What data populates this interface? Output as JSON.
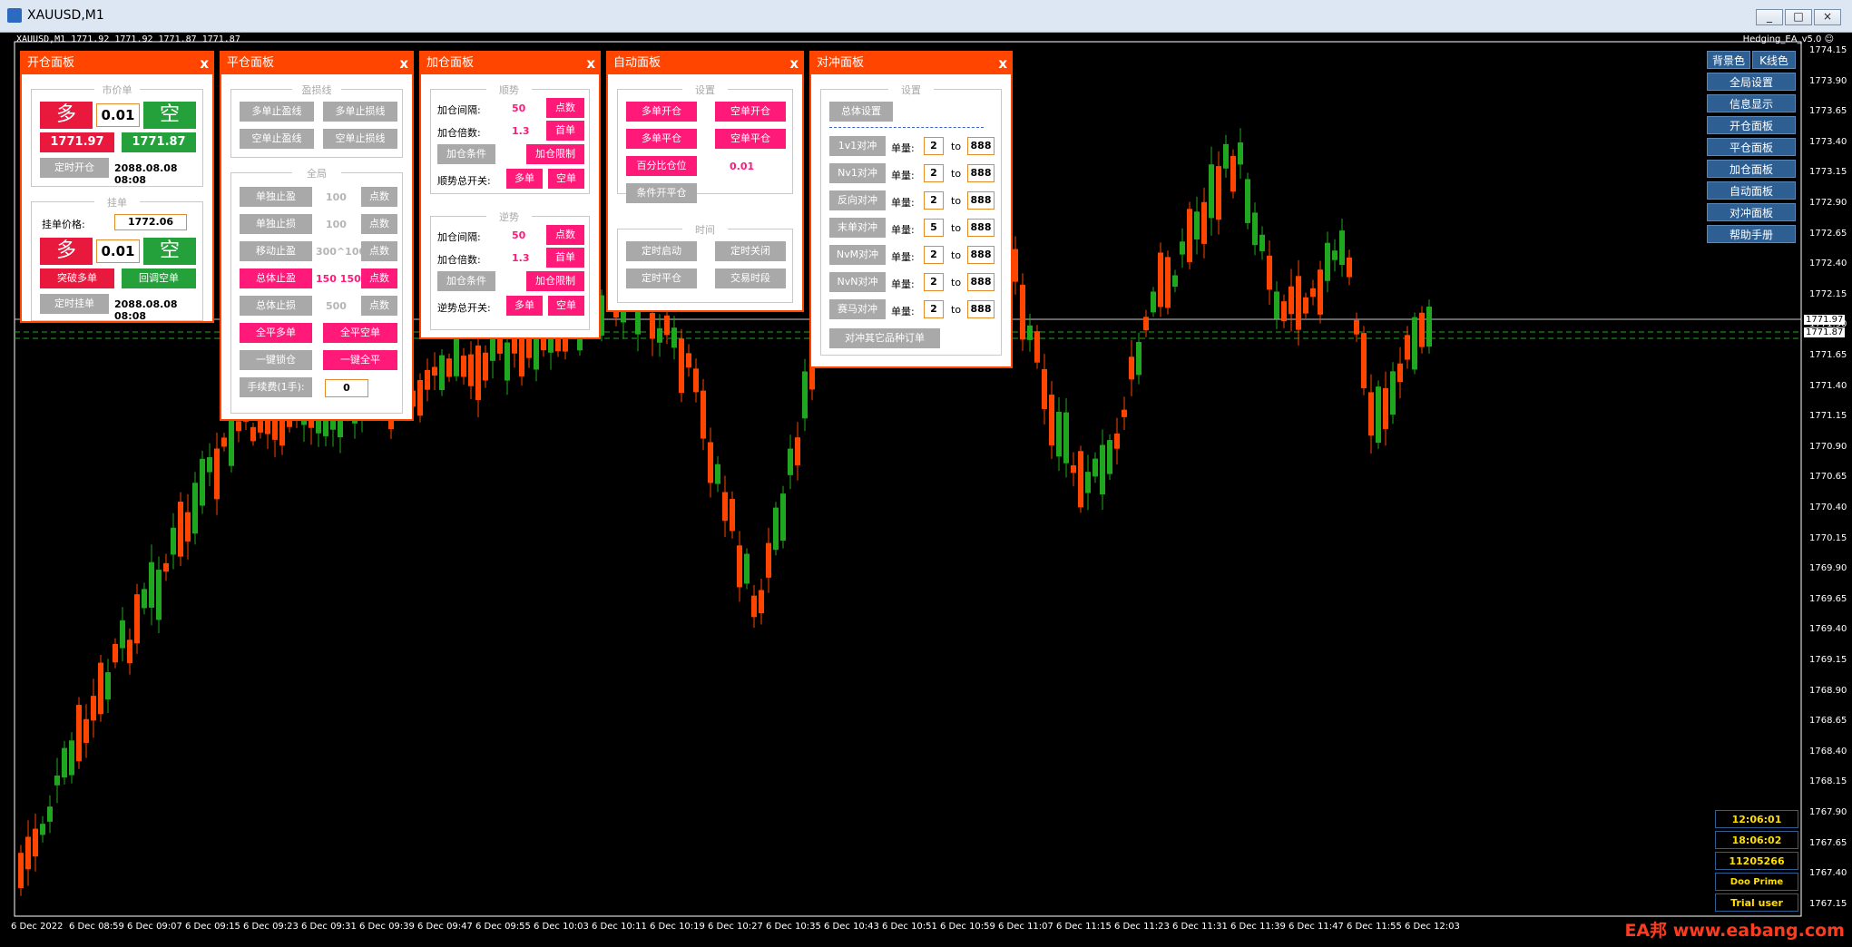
{
  "window": {
    "title": "XAUUSD,M1",
    "min": "_",
    "max": "□",
    "close": "×"
  },
  "status_line": "XAUUSD,M1  1771.92 1771.92 1771.87 1771.87",
  "ea_label": "Hedging_EA_v5.0 ☺",
  "price_axis": [
    "1774.15",
    "1773.90",
    "1773.65",
    "1773.40",
    "1773.15",
    "1772.90",
    "1772.65",
    "1772.40",
    "1772.15",
    "1771.90",
    "1771.65",
    "1771.40",
    "1771.15",
    "1770.90",
    "1770.65",
    "1770.40",
    "1770.15",
    "1769.90",
    "1769.65",
    "1769.40",
    "1769.15",
    "1768.90",
    "1768.65",
    "1768.40",
    "1768.15",
    "1767.90",
    "1767.65",
    "1767.40",
    "1767.15"
  ],
  "price_tags": {
    "bid": "1771.97",
    "ask": "1771.87"
  },
  "time_axis": [
    "6 Dec 2022",
    "6 Dec 08:59",
    "6 Dec 09:07",
    "6 Dec 09:15",
    "6 Dec 09:23",
    "6 Dec 09:31",
    "6 Dec 09:39",
    "6 Dec 09:47",
    "6 Dec 09:55",
    "6 Dec 10:03",
    "6 Dec 10:11",
    "6 Dec 10:19",
    "6 Dec 10:27",
    "6 Dec 10:35",
    "6 Dec 10:43",
    "6 Dec 10:51",
    "6 Dec 10:59",
    "6 Dec 11:07",
    "6 Dec 11:15",
    "6 Dec 11:23",
    "6 Dec 11:31",
    "6 Dec 11:39",
    "6 Dec 11:47",
    "6 Dec 11:55",
    "6 Dec 12:03"
  ],
  "colors": {
    "bull": "#1fa81f",
    "bear": "#ff4500",
    "panel": "#ff4500",
    "pink": "#ff1a7a",
    "menu": "#2e5f93"
  },
  "open_panel": {
    "title": "开仓面板",
    "close": "x",
    "market": "市价单",
    "buy": "多",
    "sell": "空",
    "lots": "0.01",
    "buy_price": "1771.97",
    "sell_price": "1771.87",
    "timed_open": "定时开仓",
    "timed_time": "2088.08.08 08:08",
    "pending": "挂单",
    "pending_price_label": "挂单价格:",
    "pending_price": "1772.06",
    "lots2": "0.01",
    "breakout_buy": "突破多单",
    "pullback_sell": "回调空单",
    "timed_pending": "定时挂单",
    "timed_time2": "2088.08.08 08:08"
  },
  "close_panel": {
    "title": "平仓面板",
    "close": "x",
    "group1": "盈损线",
    "b1": "多单止盈线",
    "b2": "多单止损线",
    "b3": "空单止盈线",
    "b4": "空单止损线",
    "group2": "全局",
    "r1": "单独止盈",
    "r1v": "100",
    "r2": "单独止损",
    "r2v": "100",
    "r3": "移动止盈",
    "r3v": "300^100",
    "r4": "总体止盈",
    "r4v": "150 150",
    "r5": "总体止损",
    "r5v": "500",
    "pts": "点数",
    "close_buy": "全平多单",
    "close_sell": "全平空单",
    "lock": "一键锁仓",
    "close_all": "一键全平",
    "fee_label": "手续费(1手):",
    "fee": "0"
  },
  "add_panel": {
    "title": "加仓面板",
    "close": "x",
    "g1": "顺势",
    "g2": "逆势",
    "interval": "加仓间隔:",
    "interval_v": "50",
    "pts": "点数",
    "mult": "加仓倍数:",
    "mult_v": "1.3",
    "first": "首单",
    "cond": "加仓条件",
    "limit": "加仓限制",
    "trend_switch": "顺势总开关:",
    "counter_switch": "逆势总开关:",
    "buy": "多单",
    "sell": "空单"
  },
  "auto_panel": {
    "title": "自动面板",
    "close": "x",
    "g1": "设置",
    "b1": "多单开仓",
    "b2": "空单开仓",
    "b3": "多单平仓",
    "b4": "空单平仓",
    "pct": "百分比仓位",
    "pct_v": "0.01",
    "cond_close": "条件开平仓",
    "g2": "时间",
    "t1": "定时启动",
    "t2": "定时关闭",
    "t3": "定时平仓",
    "t4": "交易时段"
  },
  "hedge_panel": {
    "title": "对冲面板",
    "close": "x",
    "g1": "设置",
    "overall": "总体设置",
    "rows": [
      {
        "name": "1v1对冲",
        "lots_label": "单量:",
        "a": "2",
        "to": "to",
        "b": "888"
      },
      {
        "name": "Nv1对冲",
        "lots_label": "单量:",
        "a": "2",
        "to": "to",
        "b": "888"
      },
      {
        "name": "反向对冲",
        "lots_label": "单量:",
        "a": "2",
        "to": "to",
        "b": "888"
      },
      {
        "name": "末单对冲",
        "lots_label": "单量:",
        "a": "5",
        "to": "to",
        "b": "888"
      },
      {
        "name": "NvM对冲",
        "lots_label": "单量:",
        "a": "2",
        "to": "to",
        "b": "888"
      },
      {
        "name": "NvN对冲",
        "lots_label": "单量:",
        "a": "2",
        "to": "to",
        "b": "888"
      },
      {
        "name": "赛马对冲",
        "lots_label": "单量:",
        "a": "2",
        "to": "to",
        "b": "888"
      }
    ],
    "other": "对冲其它品种订单"
  },
  "right_menu": {
    "bg": "背景色",
    "kline": "K线色",
    "items": [
      "全局设置",
      "信息显示",
      "开仓面板",
      "平仓面板",
      "加仓面板",
      "自动面板",
      "对冲面板",
      "帮助手册"
    ]
  },
  "info": {
    "time1": "12:06:01",
    "time2": "18:06:02",
    "account": "11205266",
    "broker": "Doo Prime Limited",
    "user": "Trial user"
  },
  "watermark": "EA邦 www.eabang.com"
}
